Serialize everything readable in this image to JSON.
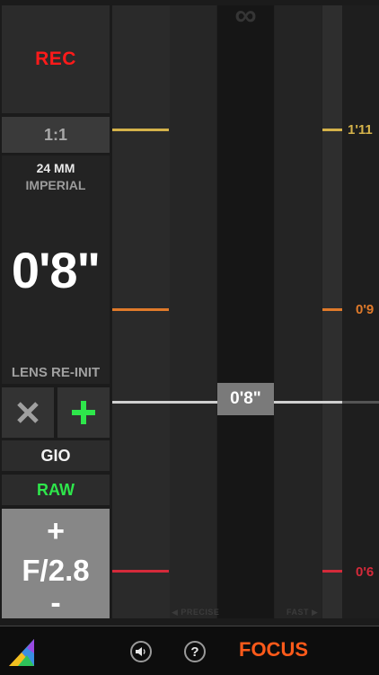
{
  "controls": {
    "rec_label": "REC",
    "aspect_ratio": "1:1",
    "focal_length": "24 MM",
    "units": "IMPERIAL",
    "focus_distance": "0'8\"",
    "lens_reinit_label": "LENS RE-INIT",
    "cancel_icon": "close-icon",
    "add_icon": "plus-icon",
    "preset_name": "GIO",
    "format_label": "RAW",
    "aperture_up": "+",
    "aperture_value": "F/2.8",
    "aperture_down": "-"
  },
  "focus_scale": {
    "infinity_symbol": "∞",
    "marks": [
      {
        "label": "1'11",
        "color": "#d4b24a"
      },
      {
        "label": "0'9",
        "color": "#e07a2a"
      },
      {
        "label": "0'6",
        "color": "#d42a3a"
      }
    ],
    "current_value": "0'8\"",
    "hint_left": "◀ PRECISE",
    "hint_right": "FAST ▶"
  },
  "bottom_bar": {
    "logo_icon": "prism-logo-icon",
    "sound_icon": "speaker-icon",
    "help_icon": "?",
    "mode_label": "FOCUS"
  },
  "colors": {
    "rec": "#ff1a1a",
    "raw": "#2ee64b",
    "focus_accent": "#ff5a1a"
  }
}
